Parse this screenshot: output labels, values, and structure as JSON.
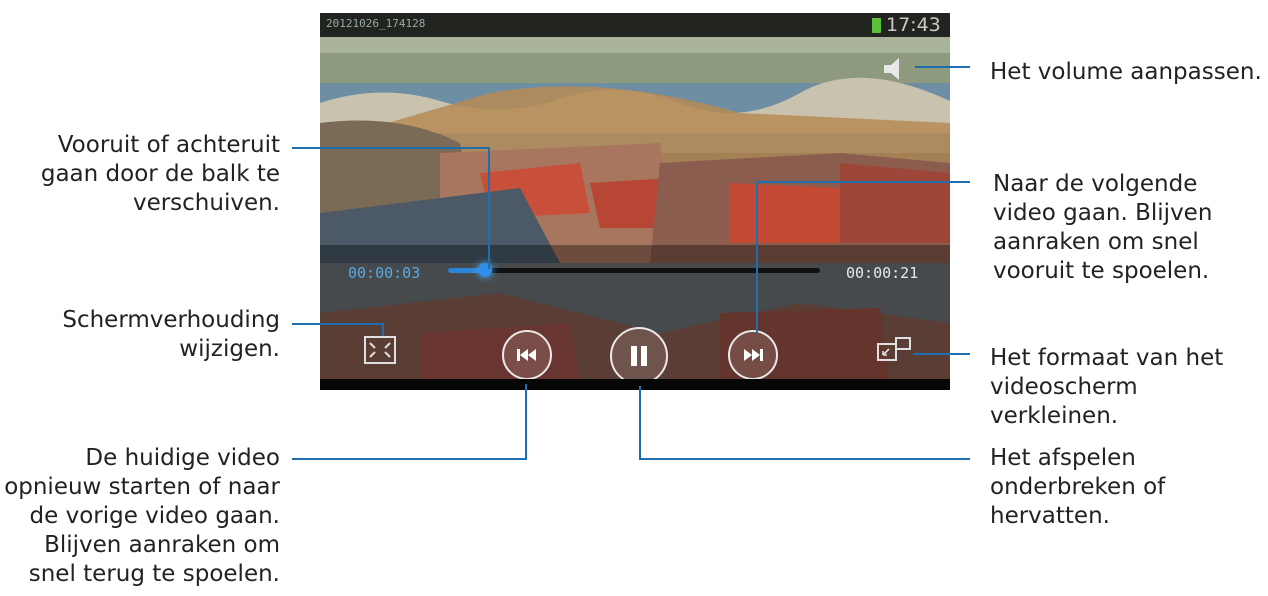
{
  "player": {
    "file_name": "20121026_174128",
    "clock": "17:43",
    "time_elapsed": "00:00:03",
    "time_total": "00:00:21",
    "seek_progress_fraction": 0.1
  },
  "callouts": {
    "volume": "Het volume aanpassen.",
    "seek": [
      "Vooruit of achteruit",
      "gaan door de balk te",
      "verschuiven."
    ],
    "next": [
      "Naar de volgende",
      "video gaan. Blijven",
      "aanraken om snel",
      "vooruit te spoelen."
    ],
    "aspect": [
      "Schermverhouding",
      "wijzigen."
    ],
    "popup": [
      "Het formaat van het",
      "videoscherm",
      "verkleinen."
    ],
    "prev": [
      "De huidige video",
      "opnieuw starten of naar",
      "de vorige video gaan.",
      "Blijven aanraken om",
      "snel terug te spoelen."
    ],
    "pause": [
      "Het afspelen",
      "onderbreken of",
      "hervatten."
    ]
  },
  "icons": {
    "volume": "volume-icon",
    "aspect": "aspect-ratio-icon",
    "prev": "previous-icon",
    "pause": "pause-icon",
    "next": "next-icon",
    "popup": "popup-player-icon"
  },
  "colors": {
    "callout_line": "#1f6fb0",
    "seek_fill": "#2a87d8",
    "battery": "#5cc23a"
  }
}
